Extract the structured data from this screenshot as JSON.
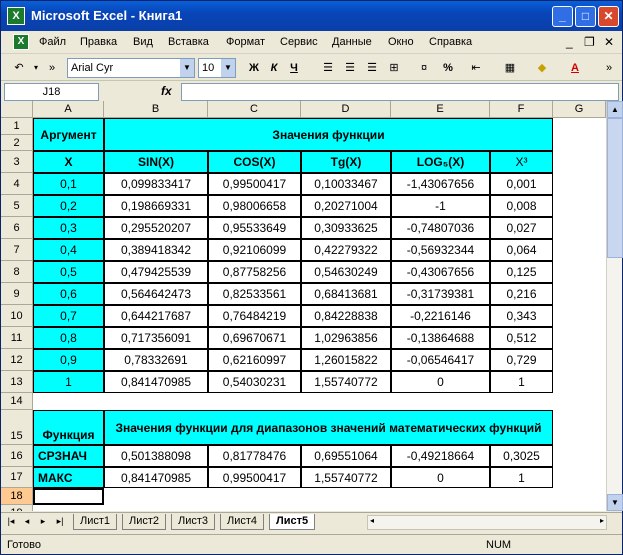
{
  "window": {
    "title": "Microsoft Excel - Книга1",
    "app_icon": "excel-icon"
  },
  "menu": [
    "Файл",
    "Правка",
    "Вид",
    "Вставка",
    "Формат",
    "Сервис",
    "Данные",
    "Окно",
    "Справка"
  ],
  "toolbar": {
    "font_name": "Arial Cyr",
    "font_size": "10",
    "bold": "Ж",
    "italic": "К",
    "underline": "Ч",
    "percent": "%"
  },
  "formula_bar": {
    "name_box": "J18",
    "fx": "fx",
    "formula": ""
  },
  "columns": [
    "A",
    "B",
    "C",
    "D",
    "E",
    "F",
    "G"
  ],
  "rows": [
    "1",
    "2",
    "3",
    "4",
    "5",
    "6",
    "7",
    "8",
    "9",
    "10",
    "11",
    "12",
    "13",
    "14",
    "15",
    "16",
    "17",
    "18",
    "19"
  ],
  "table": {
    "argument_header": "Аргумент",
    "values_header": "Значения функции",
    "x_header": "X",
    "func_headers": [
      "SIN(X)",
      "COS(X)",
      "Tg(X)",
      "LOG₅(X)",
      "X³"
    ],
    "data": [
      [
        "0,1",
        "0,099833417",
        "0,99500417",
        "0,10033467",
        "-1,43067656",
        "0,001"
      ],
      [
        "0,2",
        "0,198669331",
        "0,98006658",
        "0,20271004",
        "-1",
        "0,008"
      ],
      [
        "0,3",
        "0,295520207",
        "0,95533649",
        "0,30933625",
        "-0,74807036",
        "0,027"
      ],
      [
        "0,4",
        "0,389418342",
        "0,92106099",
        "0,42279322",
        "-0,56932344",
        "0,064"
      ],
      [
        "0,5",
        "0,479425539",
        "0,87758256",
        "0,54630249",
        "-0,43067656",
        "0,125"
      ],
      [
        "0,6",
        "0,564642473",
        "0,82533561",
        "0,68413681",
        "-0,31739381",
        "0,216"
      ],
      [
        "0,7",
        "0,644217687",
        "0,76484219",
        "0,84228838",
        "-0,2216146",
        "0,343"
      ],
      [
        "0,8",
        "0,717356091",
        "0,69670671",
        "1,02963856",
        "-0,13864688",
        "0,512"
      ],
      [
        "0,9",
        "0,78332691",
        "0,62160997",
        "1,26015822",
        "-0,06546417",
        "0,729"
      ],
      [
        "1",
        "0,841470985",
        "0,54030231",
        "1,55740772",
        "0",
        "1"
      ]
    ],
    "func_label": "Функция",
    "range_header": "Значения функции для диапазонов значений математических функций",
    "stats": [
      [
        "СРЗНАЧ",
        "0,501388098",
        "0,81778476",
        "0,69551064",
        "-0,49218664",
        "0,3025"
      ],
      [
        "МАКС",
        "0,841470985",
        "0,99500417",
        "1,55740772",
        "0",
        "1"
      ]
    ]
  },
  "sheets": [
    "Лист1",
    "Лист2",
    "Лист3",
    "Лист4",
    "Лист5"
  ],
  "active_sheet": "Лист5",
  "status": {
    "left": "Готово",
    "num": "NUM"
  },
  "colors": {
    "cyan": "#00ffff",
    "title_blue": "#0a5fd8"
  }
}
